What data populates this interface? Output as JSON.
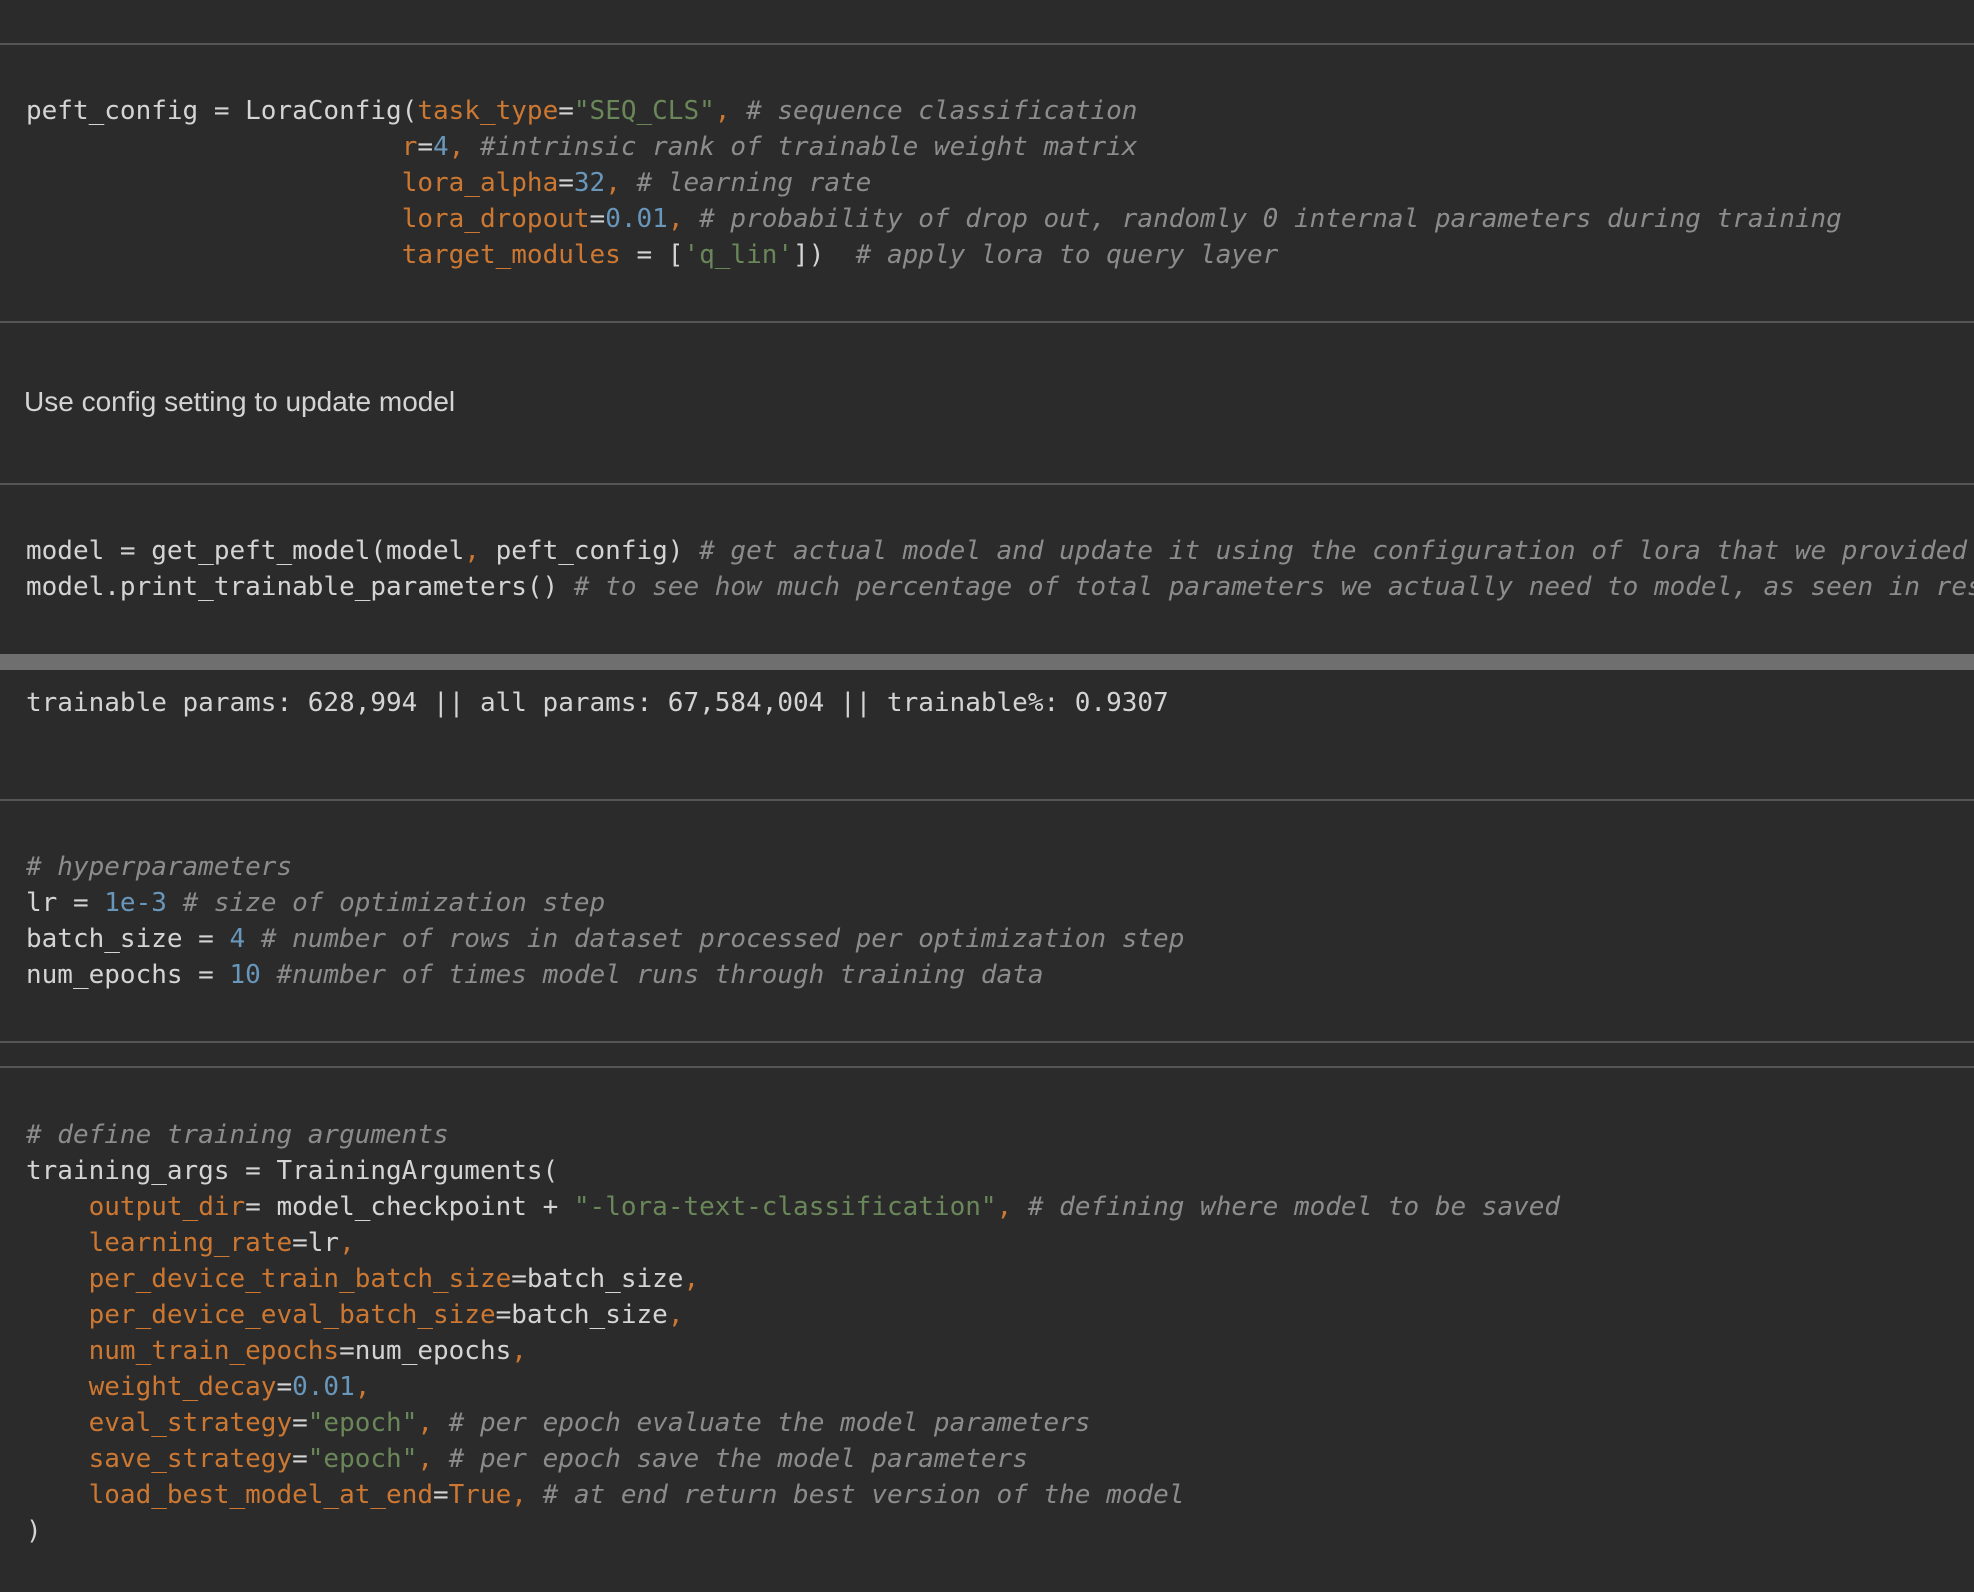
{
  "colors": {
    "background": "#2b2b2b",
    "keyword_arg": "#cc7832",
    "string": "#6a8759",
    "number": "#6897bb",
    "comment": "#8c8c8c",
    "plain": "#d4d4d4"
  },
  "cells": [
    {
      "type": "code",
      "lines": [
        [
          [
            "plain",
            "peft_config = LoraConfig("
          ],
          [
            "kw",
            "task_type"
          ],
          [
            "plain",
            "="
          ],
          [
            "str",
            "\"SEQ_CLS\""
          ],
          [
            "kw",
            ", "
          ],
          [
            "com",
            "# sequence classification"
          ]
        ],
        [
          [
            "plain",
            "                        "
          ],
          [
            "kw",
            "r"
          ],
          [
            "plain",
            "="
          ],
          [
            "num",
            "4"
          ],
          [
            "kw",
            ", "
          ],
          [
            "com",
            "#intrinsic rank of trainable weight matrix"
          ]
        ],
        [
          [
            "plain",
            "                        "
          ],
          [
            "kw",
            "lora_alpha"
          ],
          [
            "plain",
            "="
          ],
          [
            "num",
            "32"
          ],
          [
            "kw",
            ", "
          ],
          [
            "com",
            "# learning rate"
          ]
        ],
        [
          [
            "plain",
            "                        "
          ],
          [
            "kw",
            "lora_dropout"
          ],
          [
            "plain",
            "="
          ],
          [
            "num",
            "0.01"
          ],
          [
            "kw",
            ", "
          ],
          [
            "com",
            "# probability of drop out, randomly 0 internal parameters during training"
          ]
        ],
        [
          [
            "plain",
            "                        "
          ],
          [
            "kw",
            "target_modules"
          ],
          [
            "plain",
            " = ["
          ],
          [
            "str",
            "'q_lin'"
          ],
          [
            "plain",
            "])  "
          ],
          [
            "com",
            "# apply lora to query layer"
          ]
        ]
      ]
    },
    {
      "type": "markdown",
      "text": "Use config setting to update model"
    },
    {
      "type": "code",
      "lines": [
        [
          [
            "plain",
            "model = get_peft_model(model"
          ],
          [
            "kw",
            ", "
          ],
          [
            "plain",
            "peft_config) "
          ],
          [
            "com",
            "# get actual model and update it using the configuration of lora that we provided"
          ]
        ],
        [
          [
            "plain",
            "model.print_trainable_parameters() "
          ],
          [
            "com",
            "# to see how much percentage of total parameters we actually need to model, as seen in res"
          ]
        ]
      ]
    },
    {
      "type": "output",
      "text": "trainable params: 628,994 || all params: 67,584,004 || trainable%: 0.9307"
    },
    {
      "type": "code",
      "lines": [
        [
          [
            "com",
            "# hyperparameters"
          ]
        ],
        [
          [
            "plain",
            "lr = "
          ],
          [
            "num",
            "1e-3"
          ],
          [
            "plain",
            " "
          ],
          [
            "com",
            "# size of optimization step"
          ]
        ],
        [
          [
            "plain",
            "batch_size = "
          ],
          [
            "num",
            "4"
          ],
          [
            "plain",
            " "
          ],
          [
            "com",
            "# number of rows in dataset processed per optimization step"
          ]
        ],
        [
          [
            "plain",
            "num_epochs = "
          ],
          [
            "num",
            "10"
          ],
          [
            "plain",
            " "
          ],
          [
            "com",
            "#number of times model runs through training data"
          ]
        ]
      ]
    },
    {
      "type": "code",
      "lines": [
        [
          [
            "com",
            "# define training arguments"
          ]
        ],
        [
          [
            "plain",
            "training_args = TrainingArguments("
          ]
        ],
        [
          [
            "plain",
            "    "
          ],
          [
            "kw",
            "output_dir"
          ],
          [
            "plain",
            "= model_checkpoint + "
          ],
          [
            "str",
            "\"-lora-text-classification\""
          ],
          [
            "kw",
            ", "
          ],
          [
            "com",
            "# defining where model to be saved"
          ]
        ],
        [
          [
            "plain",
            "    "
          ],
          [
            "kw",
            "learning_rate"
          ],
          [
            "plain",
            "=lr"
          ],
          [
            "kw",
            ","
          ]
        ],
        [
          [
            "plain",
            "    "
          ],
          [
            "kw",
            "per_device_train_batch_size"
          ],
          [
            "plain",
            "=batch_size"
          ],
          [
            "kw",
            ","
          ]
        ],
        [
          [
            "plain",
            "    "
          ],
          [
            "kw",
            "per_device_eval_batch_size"
          ],
          [
            "plain",
            "=batch_size"
          ],
          [
            "kw",
            ","
          ]
        ],
        [
          [
            "plain",
            "    "
          ],
          [
            "kw",
            "num_train_epochs"
          ],
          [
            "plain",
            "=num_epochs"
          ],
          [
            "kw",
            ","
          ]
        ],
        [
          [
            "plain",
            "    "
          ],
          [
            "kw",
            "weight_decay"
          ],
          [
            "plain",
            "="
          ],
          [
            "num",
            "0.01"
          ],
          [
            "kw",
            ","
          ]
        ],
        [
          [
            "plain",
            "    "
          ],
          [
            "kw",
            "eval_strategy"
          ],
          [
            "plain",
            "="
          ],
          [
            "str",
            "\"epoch\""
          ],
          [
            "kw",
            ", "
          ],
          [
            "com",
            "# per epoch evaluate the model parameters"
          ]
        ],
        [
          [
            "plain",
            "    "
          ],
          [
            "kw",
            "save_strategy"
          ],
          [
            "plain",
            "="
          ],
          [
            "str",
            "\"epoch\""
          ],
          [
            "kw",
            ", "
          ],
          [
            "com",
            "# per epoch save the model parameters"
          ]
        ],
        [
          [
            "plain",
            "    "
          ],
          [
            "kw",
            "load_best_model_at_end"
          ],
          [
            "plain",
            "="
          ],
          [
            "kw",
            "True"
          ],
          [
            "kw",
            ", "
          ],
          [
            "com",
            "# at end return best version of the model"
          ]
        ],
        [
          [
            "plain",
            ")"
          ]
        ]
      ]
    }
  ]
}
